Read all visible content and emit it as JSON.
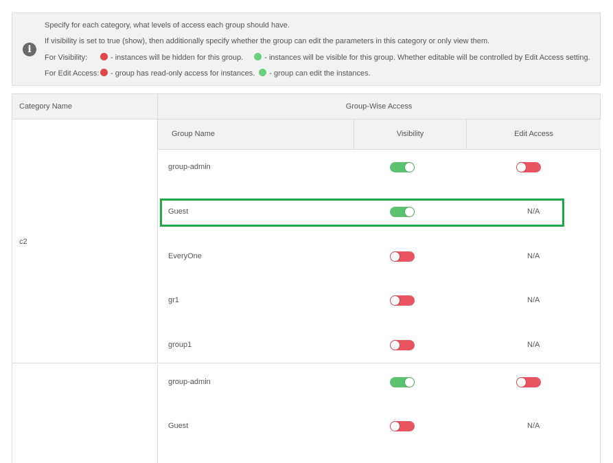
{
  "info": {
    "line1": "Specify for each category, what levels of access each group should have.",
    "line2": "If visibility is set to true (show), then additionally specify whether the group can edit the parameters in this category or only view them.",
    "visibility_label": "For Visibility:",
    "visibility_hidden": "- instances will be hidden for this group.",
    "visibility_visible": "- instances will be visible for this group. Whether editable will be controlled by Edit Access setting.",
    "edit_label": "For Edit Access:",
    "edit_readonly": "- group has read-only access for instances.",
    "edit_can": "- group can edit the instances.",
    "colors": {
      "red": "#e04848",
      "green": "#6bcf80"
    }
  },
  "table": {
    "col_category": "Category Name",
    "col_group_wise": "Group-Wise Access",
    "sub_group_name": "Group Name",
    "sub_visibility": "Visibility",
    "sub_edit_access": "Edit Access",
    "categories": [
      {
        "name": "c2",
        "groups": [
          {
            "name": "group-admin",
            "visibility": true,
            "edit": false,
            "edit_text": ""
          },
          {
            "name": "Guest",
            "visibility": true,
            "edit": null,
            "edit_text": "N/A"
          },
          {
            "name": "EveryOne",
            "visibility": false,
            "edit": null,
            "edit_text": "N/A"
          },
          {
            "name": "gr1",
            "visibility": false,
            "edit": null,
            "edit_text": "N/A"
          },
          {
            "name": "group1",
            "visibility": false,
            "edit": null,
            "edit_text": "N/A"
          }
        ]
      },
      {
        "name": "",
        "groups": [
          {
            "name": "group-admin",
            "visibility": true,
            "edit": false,
            "edit_text": ""
          },
          {
            "name": "Guest",
            "visibility": false,
            "edit": null,
            "edit_text": "N/A"
          }
        ]
      }
    ]
  },
  "highlight_color": "#1fa845"
}
